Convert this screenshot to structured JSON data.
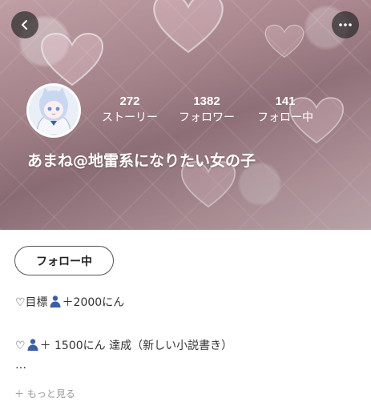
{
  "nav": {
    "back_icon": "chevron-left-icon",
    "more_icon": "more-horizontal-icon"
  },
  "profile": {
    "username": "あまね@地雷系になりたい女の子",
    "avatar_icon": "avatar-image"
  },
  "stats": {
    "stories": {
      "value": "272",
      "label": "ストーリー"
    },
    "followers": {
      "value": "1382",
      "label": "フォロワー"
    },
    "following": {
      "value": "141",
      "label": "フォロー中"
    }
  },
  "actions": {
    "follow_label": "フォロー中"
  },
  "bio": {
    "line1_prefix": "♡目標",
    "line1_suffix": "＋2000にん",
    "line2_prefix": "♡",
    "line2_suffix": "＋ 1500にん 達成（新しい小説書き）",
    "line3": "…",
    "more_label": "＋ もっと見る"
  },
  "colors": {
    "header_pink": "#b48f97",
    "button_overlay": "#282828",
    "text_primary": "#333333",
    "text_muted": "#999999",
    "person_icon_blue": "#3a5fa8"
  }
}
